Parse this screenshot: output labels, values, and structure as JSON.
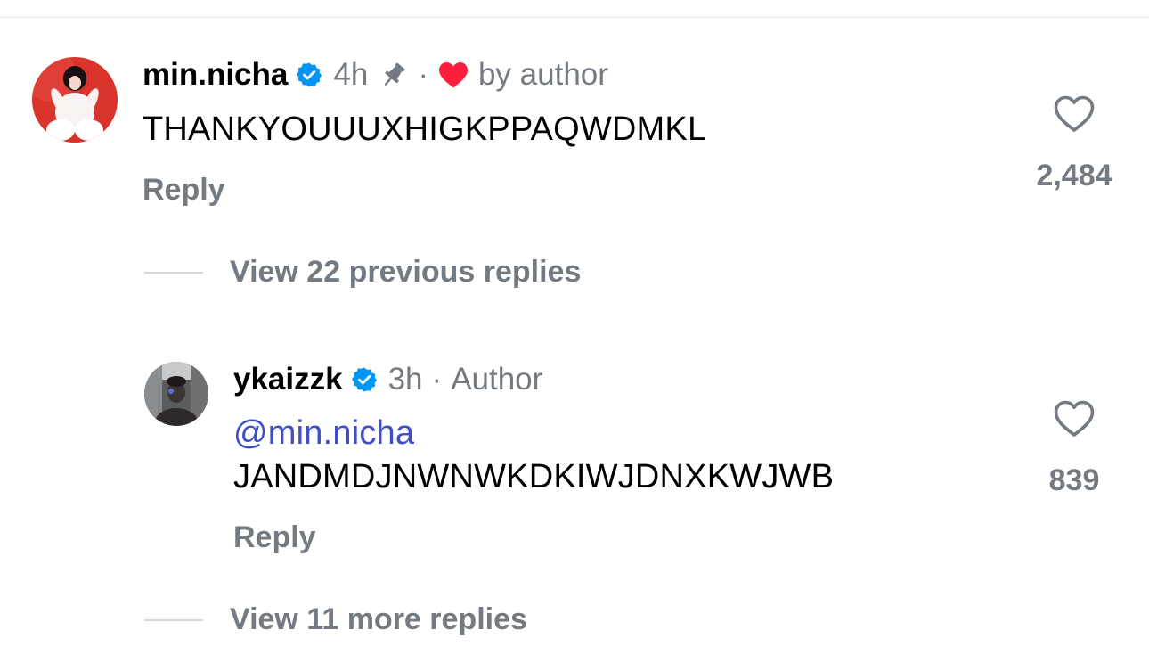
{
  "comments": [
    {
      "username": "min.nicha",
      "verified": true,
      "time": "4h",
      "pinned": true,
      "liked_by_author": true,
      "meta_text": "by author",
      "text": "THANKYOUUUXHIGKPPAQWDMKL",
      "reply_label": "Reply",
      "like_count": "2,484"
    }
  ],
  "view_previous_replies": "View 22 previous replies",
  "replies": [
    {
      "username": "ykaizzk",
      "verified": true,
      "time": "3h",
      "role": "Author",
      "mention": "@min.nicha",
      "text": "JANDMDJNWNWKDKIWJDNXKWJWB",
      "reply_label": "Reply",
      "like_count": "839"
    }
  ],
  "view_more_replies": "View 11 more replies",
  "separator": "·",
  "icons": {
    "verified": "verified-badge-icon",
    "pin": "pin-icon",
    "author_like": "red-heart-icon",
    "like": "heart-outline-icon"
  },
  "colors": {
    "secondary_text": "#737a82",
    "verified_blue": "#0095f6",
    "heart_red": "#ff1f3d",
    "mention_blue": "#3f4ec6"
  }
}
